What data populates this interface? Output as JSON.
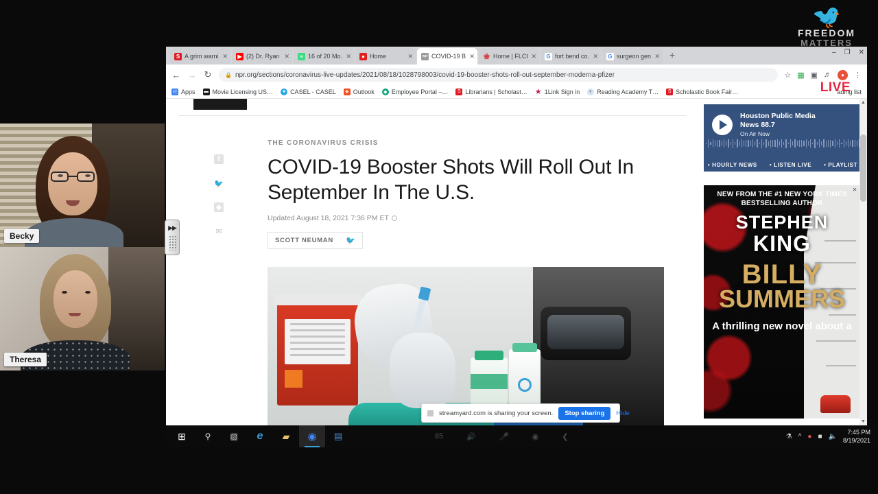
{
  "watermark": {
    "brand_line1": "FREEDOM",
    "brand_line2": "MATTERS",
    "bird_icon": "eagle-icon",
    "live_label": "LIVE"
  },
  "cams": [
    {
      "name": "Becky"
    },
    {
      "name": "Theresa"
    }
  ],
  "panel_handle": {
    "chevrons": "▶▶"
  },
  "browser": {
    "tabs": [
      {
        "label": "A grim warni…",
        "favicon": "scholastic-icon",
        "favicon_color": "#e01b24",
        "favicon_glyph": "S",
        "active": false
      },
      {
        "label": "(2) Dr. Ryan …",
        "favicon": "youtube-icon",
        "favicon_color": "#ff0000",
        "favicon_glyph": "▶",
        "active": false
      },
      {
        "label": "16 of 20 Mo…",
        "favicon": "mail-icon",
        "favicon_color": "#3ddc84",
        "favicon_glyph": "≡",
        "active": false
      },
      {
        "label": "Home",
        "favicon": "record-icon",
        "favicon_color": "#e02020",
        "favicon_glyph": "●",
        "active": false
      },
      {
        "label": "COVID-19 B…",
        "favicon": "npr-icon",
        "favicon_color": "#9a9a9a",
        "favicon_glyph": "npr",
        "active": true
      },
      {
        "label": "Home | FLCC…",
        "favicon": "flower-icon",
        "favicon_color": "#d23b3b",
        "favicon_glyph": "❀",
        "active": false
      },
      {
        "label": "fort bend co…",
        "favicon": "google-icon",
        "favicon_color": "#ffffff",
        "favicon_glyph": "G",
        "active": false
      },
      {
        "label": "surgeon gen…",
        "favicon": "google-icon",
        "favicon_color": "#ffffff",
        "favicon_glyph": "G",
        "active": false
      }
    ],
    "new_tab_label": "+",
    "tab_close_label": "✕",
    "window_controls": {
      "minimize": "–",
      "maximize": "❐",
      "close": "✕"
    },
    "nav": {
      "back": "←",
      "forward": "→",
      "reload": "↻"
    },
    "omnibox": {
      "lock_icon": "lock-icon",
      "url": "npr.org/sections/coronavirus-live-updates/2021/08/18/1028798003/covid-19-booster-shots-roll-out-september-moderna-pfizer",
      "star_icon": "star-icon"
    },
    "toolbar_icons": [
      "extension-icon",
      "cast-icon",
      "media-icon",
      "profile-avatar",
      "menu-icon"
    ],
    "profile_initial": "●",
    "bookmarks": [
      {
        "label": "Apps",
        "icon": "apps-grid-icon",
        "color": "#4285f4",
        "glyph": "☷"
      },
      {
        "label": "Movie Licensing US…",
        "icon": "film-icon",
        "color": "#1b1b1b",
        "glyph": "▬"
      },
      {
        "label": "CASEL - CASEL",
        "icon": "globe-icon",
        "color": "#2aa8e0",
        "glyph": "●"
      },
      {
        "label": "Outlook",
        "icon": "outlook-icon",
        "color": "#f25022",
        "glyph": "❖"
      },
      {
        "label": "Employee Portal –…",
        "icon": "diamond-icon",
        "color": "#12a37f",
        "glyph": "◆"
      },
      {
        "label": "Librarians | Scholast…",
        "icon": "scholastic-icon",
        "color": "#e01b24",
        "glyph": "S"
      },
      {
        "label": "1Link Sign in",
        "icon": "star-icon",
        "color": "#c2185b",
        "glyph": "★"
      },
      {
        "label": "Reading Academy T…",
        "icon": "circle-icon",
        "color": "#cfe3f5",
        "glyph": "◐"
      },
      {
        "label": "Scholastic Book Fair…",
        "icon": "scholastic-icon",
        "color": "#e01b24",
        "glyph": "S"
      }
    ],
    "reading_list_label": "ading list"
  },
  "article": {
    "kicker": "THE CORONAVIRUS CRISIS",
    "headline": "COVID-19 Booster Shots Will Roll Out In September In The U.S.",
    "updated": "Updated August 18, 2021  7:36 PM ET",
    "byline": "SCOTT NEUMAN",
    "byline_twitter_icon": "twitter-bird-icon",
    "share_icons": [
      "facebook-icon",
      "twitter-icon",
      "flipboard-icon",
      "email-icon"
    ],
    "photo_alt": "gloved-hands-preparing-vaccine-syringe"
  },
  "rail": {
    "radio": {
      "station_line1": "Houston Public Media",
      "station_line2": "News 88.7",
      "on_air": "On Air Now",
      "play_icon": "play-icon",
      "links": [
        "HOURLY NEWS",
        "LISTEN LIVE",
        "PLAYLIST"
      ]
    },
    "ad": {
      "line1": "NEW FROM THE #1 NEW YORK TIMES",
      "line2": "BESTSELLING AUTHOR",
      "author_first": "STEPHEN",
      "author_last": "KING",
      "title_line1": "BILLY",
      "title_line2": "SUMMERS",
      "tagline": "A thrilling new novel about a",
      "close_label": "✕"
    }
  },
  "share_notice": {
    "message": "streamyard.com is sharing your screen.",
    "stop_label": "Stop sharing",
    "hide_label": "Hide"
  },
  "taskbar": {
    "items": [
      {
        "name": "start-button",
        "icon": "windows-icon",
        "glyph": "⊞",
        "color": "#ffffff",
        "active": false
      },
      {
        "name": "search-button",
        "icon": "search-icon",
        "glyph": "⚲",
        "color": "#e0e0e0",
        "active": false
      },
      {
        "name": "task-view-button",
        "icon": "task-view-icon",
        "glyph": "▧",
        "color": "#e0e0e0",
        "active": false
      },
      {
        "name": "edge-button",
        "icon": "edge-icon",
        "glyph": "e",
        "color": "#3aa0e0",
        "active": false
      },
      {
        "name": "file-explorer-button",
        "icon": "folder-icon",
        "glyph": "▰",
        "color": "#e8c06a",
        "active": false
      },
      {
        "name": "chrome-button",
        "icon": "chrome-icon",
        "glyph": "◉",
        "color": "#4285f4",
        "active": true
      },
      {
        "name": "office-button",
        "icon": "office-icon",
        "glyph": "▤",
        "color": "#2b579a",
        "active": false
      }
    ],
    "media_controls": [
      "volume-icon",
      "microphone-icon",
      "camera-off-icon",
      "back-icon"
    ],
    "tray": [
      "network-share-icon",
      "show-hidden-icon",
      "security-icon",
      "battery-icon",
      "volume-icon"
    ],
    "clock_time": "7:45 PM",
    "clock_date": "8/19/2021"
  }
}
